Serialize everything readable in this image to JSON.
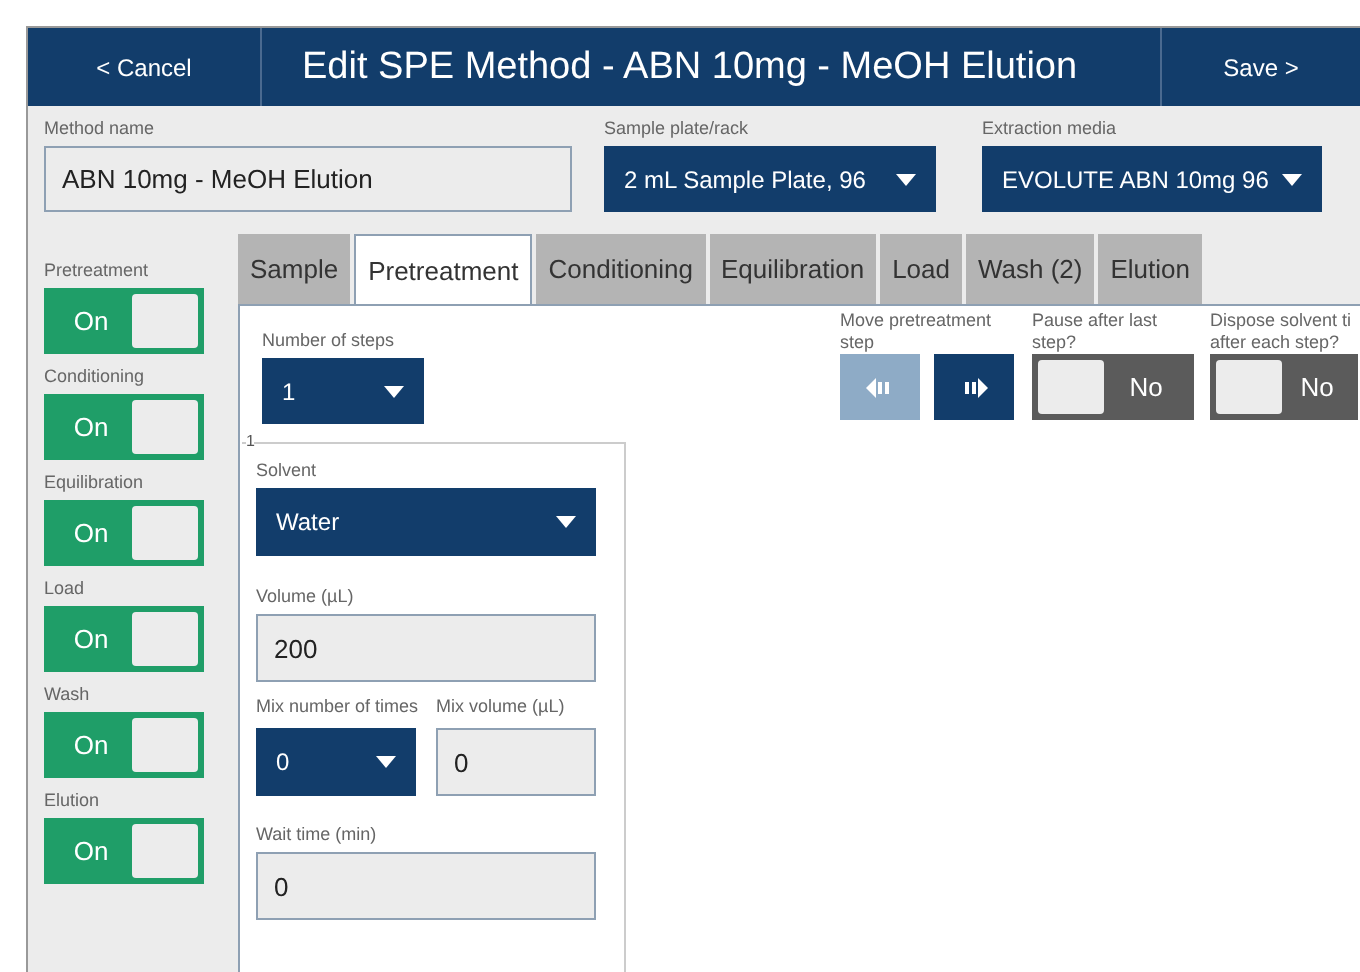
{
  "header": {
    "cancel": "< Cancel",
    "title": "Edit SPE Method - ABN 10mg - MeOH Elution",
    "save": "Save >"
  },
  "method_name": {
    "label": "Method name",
    "value": "ABN 10mg - MeOH Elution"
  },
  "sample_plate": {
    "label": "Sample plate/rack",
    "value": "2 mL Sample Plate, 96"
  },
  "extraction_media": {
    "label": "Extraction media",
    "value": "EVOLUTE ABN 10mg 96"
  },
  "stages": [
    {
      "label": "Pretreatment",
      "on": true,
      "text": "On"
    },
    {
      "label": "Conditioning",
      "on": true,
      "text": "On"
    },
    {
      "label": "Equilibration",
      "on": true,
      "text": "On"
    },
    {
      "label": "Load",
      "on": true,
      "text": "On"
    },
    {
      "label": "Wash",
      "on": true,
      "text": "On"
    },
    {
      "label": "Elution",
      "on": true,
      "text": "On"
    }
  ],
  "tabs": [
    {
      "label": "Sample",
      "selected": false
    },
    {
      "label": "Pretreatment",
      "selected": true
    },
    {
      "label": "Conditioning",
      "selected": false
    },
    {
      "label": "Equilibration",
      "selected": false
    },
    {
      "label": "Load",
      "selected": false
    },
    {
      "label": "Wash (2)",
      "selected": false
    },
    {
      "label": "Elution",
      "selected": false
    }
  ],
  "number_of_steps": {
    "label": "Number of steps",
    "value": "1"
  },
  "move_step": {
    "label": "Move pretreatment step",
    "left_disabled": true,
    "right_disabled": false
  },
  "pause_after_last": {
    "label": "Pause after last step?",
    "on": false,
    "text": "No"
  },
  "dispose_tip": {
    "label_lines": [
      "Dispose solvent ti",
      "after each step?"
    ],
    "on": false,
    "text": "No"
  },
  "step": {
    "number": "1",
    "solvent": {
      "label": "Solvent",
      "value": "Water"
    },
    "volume": {
      "label": "Volume (µL)",
      "value": "200"
    },
    "mix_times": {
      "label": "Mix number of times",
      "value": "0"
    },
    "mix_volume": {
      "label": "Mix volume (µL)",
      "value": "0"
    },
    "wait_time": {
      "label": "Wait time (min)",
      "value": "0"
    }
  }
}
